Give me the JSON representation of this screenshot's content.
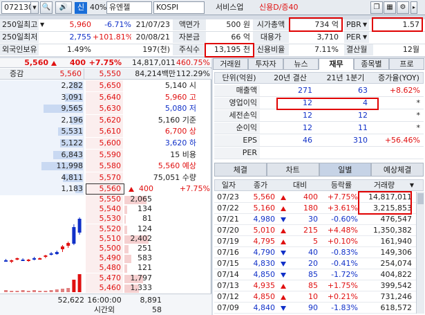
{
  "topbar": {
    "code": "072130",
    "name_badge": "신",
    "margin_rate": "40%",
    "stock_name": "유엔젤",
    "market": "KOSPI",
    "sector": "서비스업",
    "credit": "신용D/증40"
  },
  "info": {
    "row1": {
      "label": "250일최고",
      "price": "5,960",
      "rate": "-6.71%",
      "date": "21/07/23",
      "k1": "액면가",
      "v1": "500 원",
      "k2": "시가총액",
      "v2": "734 억",
      "k3": "PBR",
      "v3": "1.57"
    },
    "row2": {
      "label": "250일최저",
      "price": "2,755",
      "rate": "+101.81%",
      "date": "20/08/21",
      "k1": "자본금",
      "v1": "66 억",
      "k2": "대용가",
      "v2": "3,710",
      "k3": "PER",
      "v3": ""
    },
    "row3": {
      "label": "외국인보유",
      "rate": "1.49%",
      "qty": "197(천)",
      "k1": "주식수",
      "v1": "13,195 천",
      "k2": "신용비율",
      "v2": "7.11%",
      "k3": "결산월",
      "v3": "12월"
    }
  },
  "quote": {
    "price": "5,560",
    "change": "400",
    "rate": "+7.75%",
    "volume": "14,817,011",
    "vol_rate": "460.75%",
    "header_label": "증감",
    "header_price": "5,560",
    "header_price2": "5,550",
    "header_amount": "84,214백만",
    "header_pct": "112.29%"
  },
  "asks": [
    {
      "qty": "2,282",
      "price": "5,650",
      "info": "5,140 시",
      "bar": 0.32
    },
    {
      "qty": "3,091",
      "price": "5,640",
      "info": "5,960 고",
      "bar": 0.43
    },
    {
      "qty": "9,565",
      "price": "5,630",
      "info": "5,080 저",
      "bar": 0.95
    },
    {
      "qty": "2,196",
      "price": "5,620",
      "info": "5,160 기준",
      "bar": 0.3
    },
    {
      "qty": "5,531",
      "price": "5,610",
      "info": "6,700 상",
      "bar": 0.6
    },
    {
      "qty": "5,122",
      "price": "5,600",
      "info": "3,620 하",
      "bar": 0.55
    },
    {
      "qty": "6,843",
      "price": "5,590",
      "info": "15 비용",
      "bar": 0.72
    },
    {
      "qty": "11,998",
      "price": "5,580",
      "info": "5,560 예상",
      "bar": 1.0
    },
    {
      "qty": "4,811",
      "price": "5,570",
      "info": "75,051 수량",
      "bar": 0.48
    },
    {
      "qty": "1,183",
      "price": "5,560",
      "info": "400",
      "info2": "+7.75%",
      "bar": 0.18
    }
  ],
  "bids": [
    {
      "price": "5,550",
      "qty": "2,065",
      "bar": 0.45
    },
    {
      "price": "5,540",
      "qty": "134",
      "bar": 0.05
    },
    {
      "price": "5,530",
      "qty": "81",
      "bar": 0.03
    },
    {
      "price": "5,520",
      "qty": "124",
      "bar": 0.05
    },
    {
      "price": "5,510",
      "qty": "2,402",
      "bar": 0.5
    },
    {
      "price": "5,500",
      "qty": "251",
      "bar": 0.08
    },
    {
      "price": "5,490",
      "qty": "583",
      "bar": 0.14
    },
    {
      "price": "5,480",
      "qty": "121",
      "bar": 0.05
    },
    {
      "price": "5,470",
      "qty": "1,797",
      "bar": 0.38
    },
    {
      "price": "5,460",
      "qty": "1,333",
      "bar": 0.3
    }
  ],
  "ob_footer": {
    "left": "52,622",
    "time": "16:00:00",
    "right": "8,891",
    "after_label": "시간외",
    "after_val": "58"
  },
  "tabs": [
    "거래원",
    "투자자",
    "뉴스",
    "재무",
    "종목별",
    "프로"
  ],
  "fin": {
    "headers": [
      "단위(억원)",
      "20년 결산",
      "21년 1분기",
      "증가율(YOY)"
    ],
    "rows": [
      {
        "label": "매출액",
        "a": "271",
        "b": "63",
        "c": "+8.62%"
      },
      {
        "label": "영업이익",
        "a": "12",
        "b": "4",
        "c": "*"
      },
      {
        "label": "세전손익",
        "a": "12",
        "b": "12",
        "c": "*"
      },
      {
        "label": "순이익",
        "a": "12",
        "b": "11",
        "c": "*"
      },
      {
        "label": "EPS",
        "a": "46",
        "b": "310",
        "c": "+56.46%"
      },
      {
        "label": "PER",
        "a": "",
        "b": "",
        "c": ""
      }
    ]
  },
  "subtabs": [
    "체결",
    "차트",
    "일별",
    "예상체결"
  ],
  "daily": {
    "headers": [
      "일자",
      "종가",
      "대비",
      "등락률",
      "거래량"
    ],
    "rows": [
      {
        "date": "07/23",
        "close": "5,560",
        "dir": "up",
        "diff": "400",
        "rate": "+7.75%",
        "vol": "14,817,011"
      },
      {
        "date": "07/22",
        "close": "5,160",
        "dir": "up",
        "diff": "180",
        "rate": "+3.61%",
        "vol": "3,215,853"
      },
      {
        "date": "07/21",
        "close": "4,980",
        "dir": "down",
        "diff": "30",
        "rate": "-0.60%",
        "vol": "476,547"
      },
      {
        "date": "07/20",
        "close": "5,010",
        "dir": "up",
        "diff": "215",
        "rate": "+4.48%",
        "vol": "1,350,382"
      },
      {
        "date": "07/19",
        "close": "4,795",
        "dir": "up",
        "diff": "5",
        "rate": "+0.10%",
        "vol": "161,940"
      },
      {
        "date": "07/16",
        "close": "4,790",
        "dir": "down",
        "diff": "40",
        "rate": "-0.83%",
        "vol": "149,306"
      },
      {
        "date": "07/15",
        "close": "4,830",
        "dir": "down",
        "diff": "20",
        "rate": "-0.41%",
        "vol": "254,074"
      },
      {
        "date": "07/14",
        "close": "4,850",
        "dir": "down",
        "diff": "85",
        "rate": "-1.72%",
        "vol": "404,822"
      },
      {
        "date": "07/13",
        "close": "4,935",
        "dir": "up",
        "diff": "85",
        "rate": "+1.75%",
        "vol": "399,542"
      },
      {
        "date": "07/12",
        "close": "4,850",
        "dir": "up",
        "diff": "10",
        "rate": "+0.21%",
        "vol": "731,246"
      },
      {
        "date": "07/09",
        "close": "4,840",
        "dir": "down",
        "diff": "90",
        "rate": "-1.83%",
        "vol": "618,572"
      }
    ]
  },
  "colors": {
    "up": "#e01010",
    "down": "#1030c8",
    "highlight": "#e00000"
  }
}
